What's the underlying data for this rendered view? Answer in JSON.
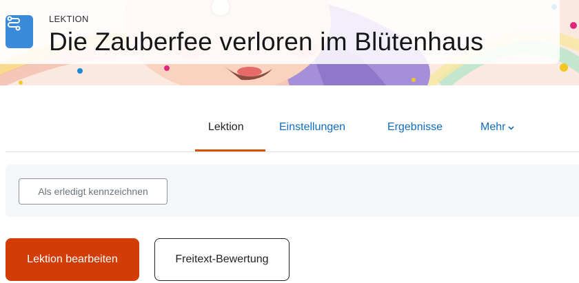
{
  "header": {
    "kicker": "LEKTION",
    "title": "Die Zauberfee verloren im Blütenhaus",
    "icon": "lesson-icon",
    "icon_color": "#3b8ad9"
  },
  "nav": {
    "tabs": [
      {
        "label": "Lektion",
        "active": true
      },
      {
        "label": "Einstellungen",
        "active": false
      },
      {
        "label": "Ergebnisse",
        "active": false
      },
      {
        "label": "Mehr",
        "active": false,
        "icon": "chevron-down-icon"
      }
    ],
    "active_color": "#d35400"
  },
  "completion": {
    "button_label": "Als erledigt kennzeichnen"
  },
  "actions": {
    "edit_label": "Lektion bearbeiten",
    "edit_color": "#d23c06",
    "essay_label": "Freitext-Bewertung"
  }
}
